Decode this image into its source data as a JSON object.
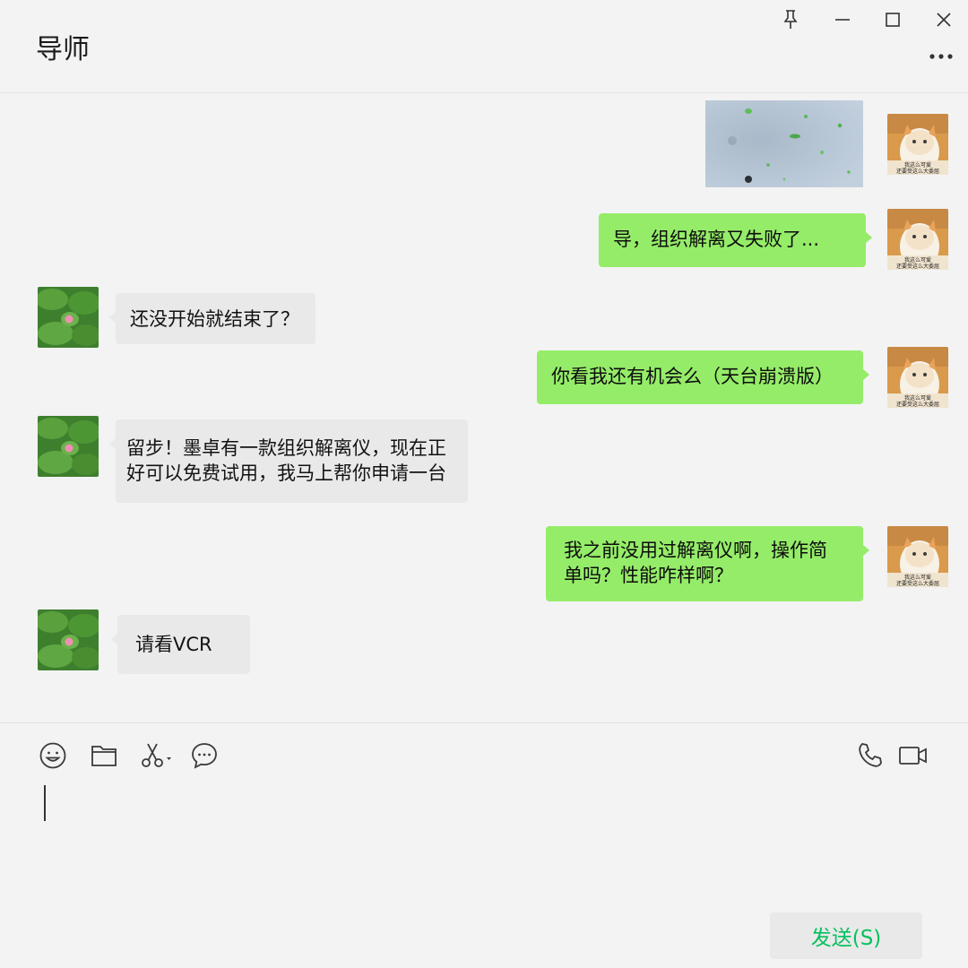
{
  "window": {
    "title": "导师",
    "icons": [
      "pin-icon",
      "minimize-icon",
      "maximize-icon",
      "close-icon",
      "more-icon"
    ]
  },
  "messages": [
    {
      "sender": "self",
      "type": "image",
      "caption": "我这么可爱 还要受这么大委屈"
    },
    {
      "sender": "self",
      "type": "text",
      "text": "导，组织解离又失败了..."
    },
    {
      "sender": "other",
      "type": "text",
      "text": "还没开始就结束了？"
    },
    {
      "sender": "self",
      "type": "text",
      "text": "你看我还有机会么（天台崩溃版）"
    },
    {
      "sender": "other",
      "type": "text",
      "lines": [
        "留步！墨卓有一款组织解离仪，现在正",
        "好可以免费试用，我马上帮你申请一台"
      ]
    },
    {
      "sender": "self",
      "type": "text",
      "lines": [
        "我之前没用过解离仪啊，操作简",
        "单吗？性能咋样啊？"
      ]
    },
    {
      "sender": "other",
      "type": "text",
      "text": "请看VCR"
    }
  ],
  "self_avatar": {
    "caption": [
      "我这么可爱",
      "还要受这么大委屈"
    ]
  },
  "toolbar": {
    "icons": [
      "emoji-icon",
      "folder-icon",
      "scissors-icon",
      "chat-bubble-icon",
      "phone-icon",
      "video-icon"
    ]
  },
  "input": {
    "value": ""
  },
  "send_button": {
    "label": "发送(S)"
  },
  "colors": {
    "self_bubble": "#95ec69",
    "other_bubble": "#e9e9e9",
    "send_text": "#07c160",
    "background": "#f3f3f3"
  }
}
